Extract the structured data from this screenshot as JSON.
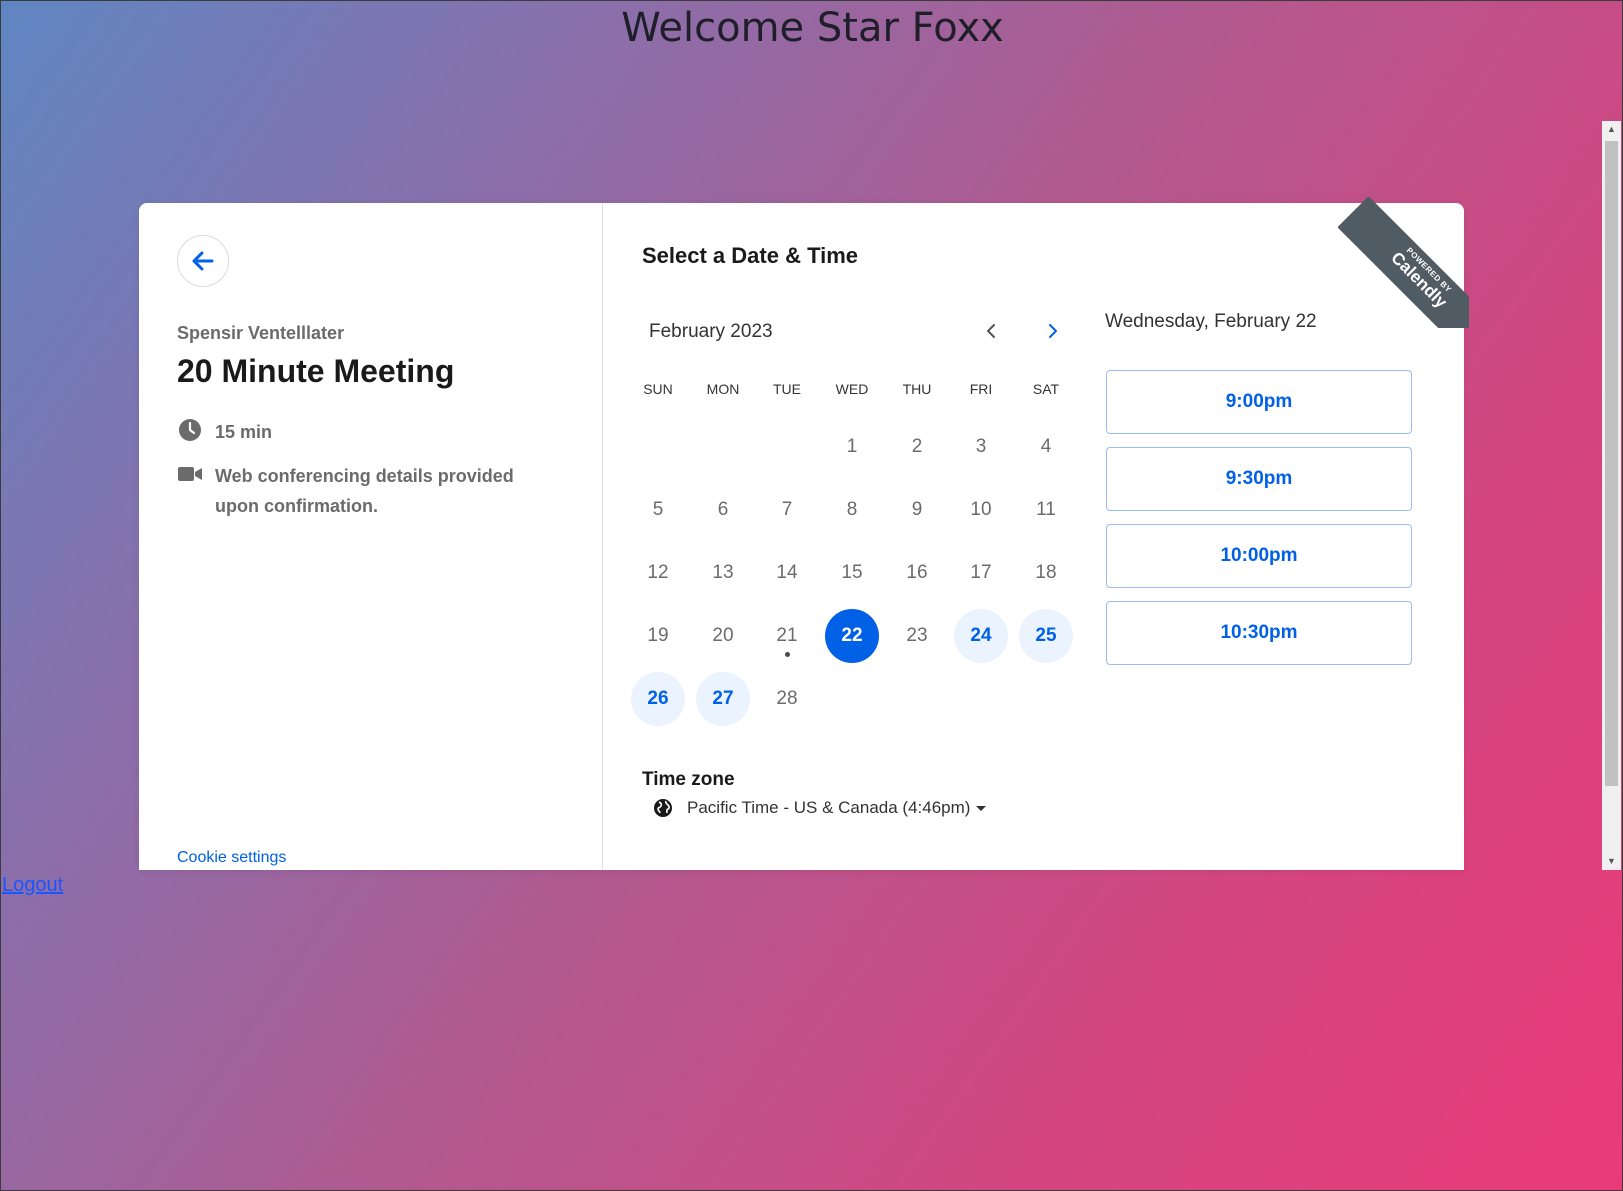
{
  "page": {
    "title": "Welcome Star Foxx",
    "logout_label": "Logout"
  },
  "event": {
    "organizer": "Spensir Ventelllater",
    "title": "20 Minute Meeting",
    "duration": "15 min",
    "conferencing": "Web conferencing details provided upon confirmation.",
    "cookie_settings": "Cookie settings"
  },
  "calendar": {
    "section_title": "Select a Date & Time",
    "month_label": "February 2023",
    "weekdays": [
      "SUN",
      "MON",
      "TUE",
      "WED",
      "THU",
      "FRI",
      "SAT"
    ],
    "days": [
      "1",
      "2",
      "3",
      "4",
      "5",
      "6",
      "7",
      "8",
      "9",
      "10",
      "11",
      "12",
      "13",
      "14",
      "15",
      "16",
      "17",
      "18",
      "19",
      "20",
      "21",
      "22",
      "23",
      "24",
      "25",
      "26",
      "27",
      "28"
    ],
    "first_weekday_index": 3,
    "selected_day": "22",
    "available_days": [
      "22",
      "24",
      "25",
      "26",
      "27"
    ],
    "today_day": "21",
    "accent_color": "#0060e6"
  },
  "timezone": {
    "title": "Time zone",
    "value": "Pacific Time - US & Canada (4:46pm)"
  },
  "slots": {
    "date_heading": "Wednesday, February 22",
    "times": [
      "9:00pm",
      "9:30pm",
      "10:00pm",
      "10:30pm"
    ]
  },
  "ribbon": {
    "powered_by": "POWERED BY",
    "brand": "Calendly"
  },
  "icons": {
    "back": "arrow-left-icon",
    "prev_month": "chevron-left-icon",
    "next_month": "chevron-right-icon",
    "duration": "clock-icon",
    "conferencing": "video-camera-icon",
    "timezone": "globe-icon"
  }
}
